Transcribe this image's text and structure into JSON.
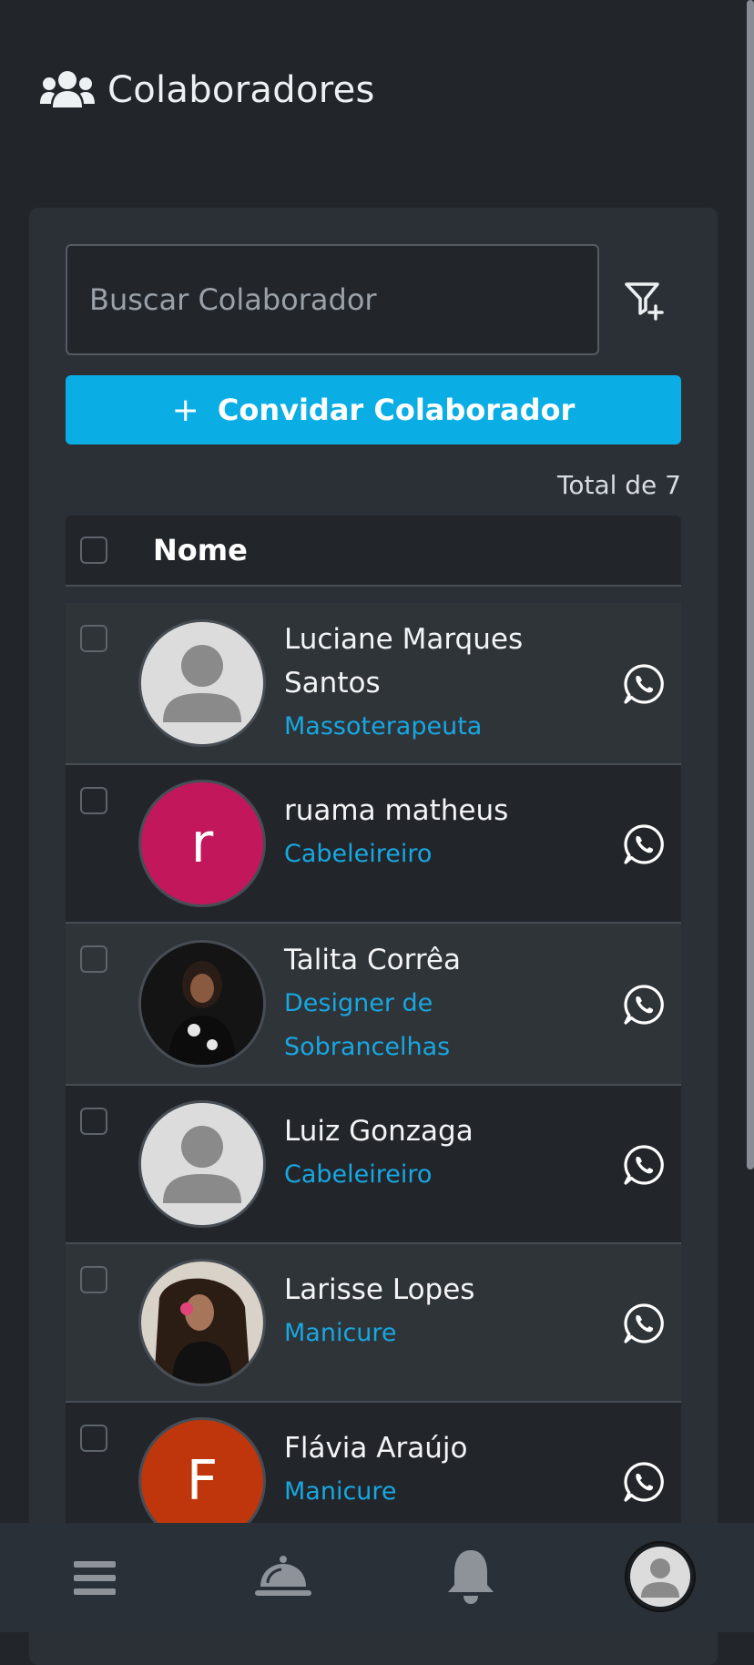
{
  "header": {
    "title": "Colaboradores",
    "icon": "users-icon"
  },
  "search": {
    "placeholder": "Buscar Colaborador",
    "value": ""
  },
  "filter": {
    "icon": "filter-plus-icon"
  },
  "invite": {
    "label": "Convidar Colaborador",
    "icon": "plus-icon"
  },
  "list": {
    "total_label": "Total de 7",
    "header_label": "Nome",
    "rows": [
      {
        "name": "Luciane Marques Santos",
        "role": "Massoterapeuta",
        "avatar": "default",
        "letter": ""
      },
      {
        "name": "ruama matheus",
        "role": "Cabeleireiro",
        "avatar": "letter",
        "letter": "r",
        "avatar_color": "#c2185b"
      },
      {
        "name": "Talita Corrêa",
        "role": "Designer de Sobrancelhas",
        "avatar": "photo",
        "letter": ""
      },
      {
        "name": "Luiz Gonzaga",
        "role": "Cabeleireiro",
        "avatar": "default",
        "letter": ""
      },
      {
        "name": "Larisse Lopes",
        "role": "Manicure",
        "avatar": "photo",
        "letter": ""
      },
      {
        "name": "Flávia Araújo",
        "role": "Manicure",
        "avatar": "letter",
        "letter": "F",
        "avatar_color": "#bf360c"
      }
    ]
  },
  "nav": {
    "items": [
      {
        "icon": "menu-icon"
      },
      {
        "icon": "service-bell-icon"
      },
      {
        "icon": "bell-icon"
      },
      {
        "icon": "profile-avatar-icon"
      }
    ]
  },
  "colors": {
    "accent": "#0aaee4",
    "role_text": "#18a7e0",
    "background": "#22262b",
    "card": "#2b3036"
  }
}
